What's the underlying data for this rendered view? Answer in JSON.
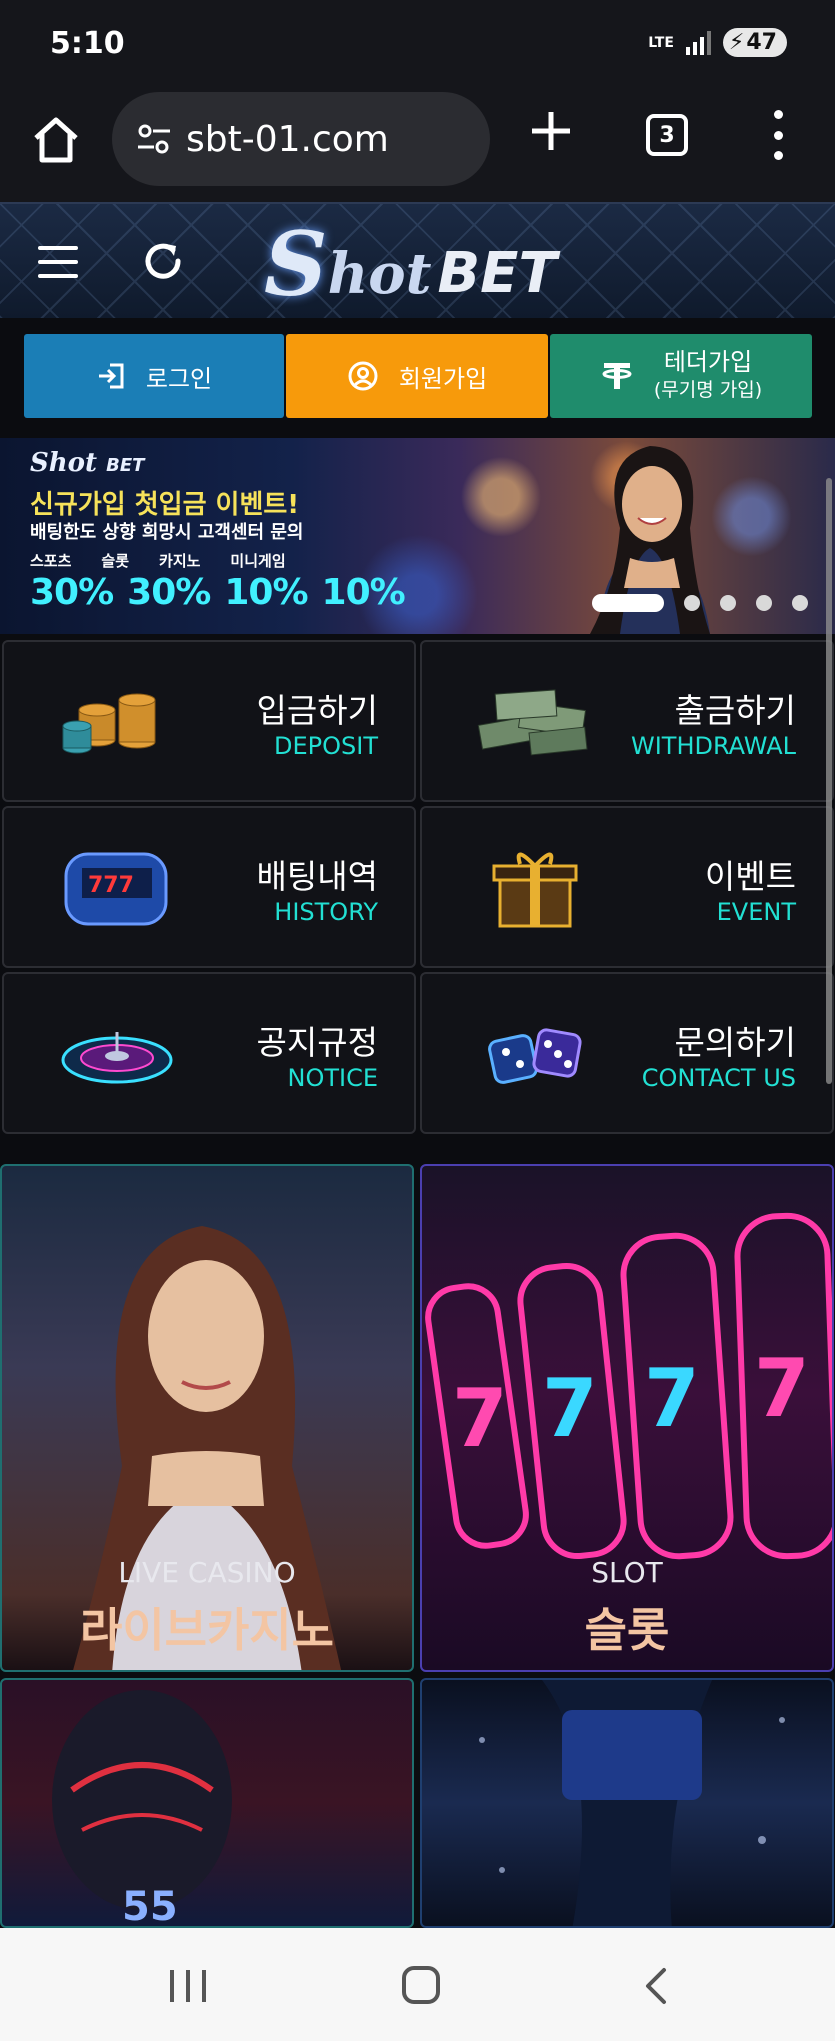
{
  "status_bar": {
    "time": "5:10",
    "network": "LTE",
    "battery": "47"
  },
  "browser": {
    "url": "sbt-01.com",
    "tab_count": "3"
  },
  "site": {
    "logo_s": "S",
    "logo_hot": "hot",
    "logo_bet": "BET"
  },
  "auth": {
    "login": "로그인",
    "signup": "회원가입",
    "tether": "테더가입",
    "tether_sub": "(무기명 가입)"
  },
  "banner": {
    "logo_s": "Shot",
    "logo_bet": "BET",
    "title": "신규가입 첫입금 이벤트!",
    "subtitle": "배팅한도 상향 희망시 고객센터 문의",
    "categories": [
      "스포츠",
      "슬롯",
      "카지노",
      "미니게임"
    ],
    "percents": [
      "30%",
      "30%",
      "10%",
      "10%"
    ],
    "slide_count": 5,
    "active_slide": 1
  },
  "menu": [
    {
      "ko": "입금하기",
      "en": "DEPOSIT",
      "icon": "coins-icon"
    },
    {
      "ko": "출금하기",
      "en": "WITHDRAWAL",
      "icon": "cash-stack-icon"
    },
    {
      "ko": "배팅내역",
      "en": "HISTORY",
      "icon": "slot-reel-icon"
    },
    {
      "ko": "이벤트",
      "en": "EVENT",
      "icon": "gift-box-icon"
    },
    {
      "ko": "공지규정",
      "en": "NOTICE",
      "icon": "roulette-icon"
    },
    {
      "ko": "문의하기",
      "en": "CONTACT US",
      "icon": "dice-icon"
    }
  ],
  "categories": {
    "live": {
      "en": "LIVE CASINO",
      "ko": "라이브카지노"
    },
    "slot": {
      "en": "SLOT",
      "ko": "슬롯"
    }
  },
  "colors": {
    "login": "#1b7eb6",
    "signup": "#f79a0b",
    "tether": "#1f8c6c",
    "accent_teal": "#22e0d3",
    "percent_cyan": "#41f0ff"
  }
}
